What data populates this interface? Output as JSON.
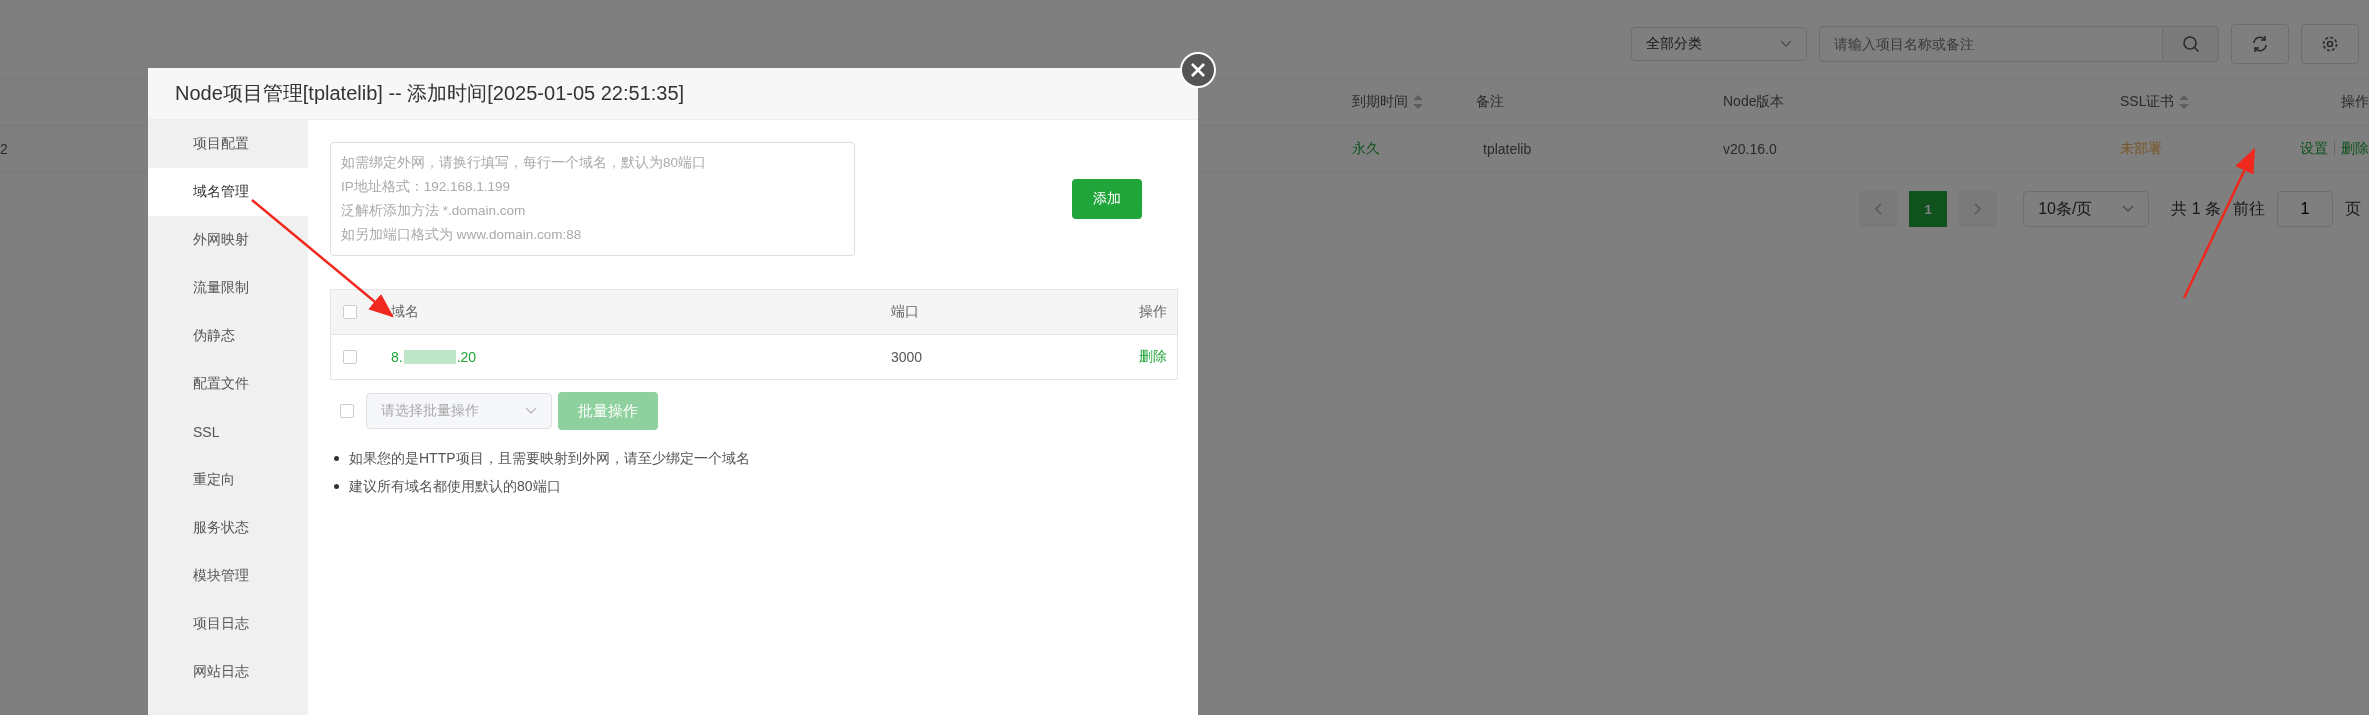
{
  "toolbar": {
    "category_select": "全部分类",
    "search": {
      "placeholder": "请输入项目名称或备注"
    }
  },
  "table": {
    "columns": [
      {
        "label": "到期时间",
        "sortable": true
      },
      {
        "label": "备注",
        "sortable": false
      },
      {
        "label": "Node版本",
        "sortable": false
      },
      {
        "label": "SSL证书",
        "sortable": true
      },
      {
        "label": "操作",
        "sortable": false
      }
    ],
    "rows": [
      {
        "cut_cell": "2",
        "cells": [
          "永久",
          "tplatelib",
          "v20.16.0",
          "未部署"
        ],
        "actions": [
          "设置",
          "删除"
        ]
      }
    ]
  },
  "pagination": {
    "pages": [
      {
        "label": "1",
        "selected": true
      }
    ],
    "page_size": "10条/页",
    "total": "共 1 条",
    "goto_label": "前往",
    "goto_value": "1",
    "page_suffix": "页"
  },
  "dialog": {
    "title": "Node项目管理[tplatelib] -- 添加时间[2025-01-05 22:51:35]",
    "menu": [
      {
        "label": "项目配置",
        "selected": false
      },
      {
        "label": "域名管理",
        "selected": true
      },
      {
        "label": "外网映射",
        "selected": false
      },
      {
        "label": "流量限制",
        "selected": false
      },
      {
        "label": "伪静态",
        "selected": false
      },
      {
        "label": "配置文件",
        "selected": false
      },
      {
        "label": "SSL",
        "selected": false
      },
      {
        "label": "重定向",
        "selected": false
      },
      {
        "label": "服务状态",
        "selected": false
      },
      {
        "label": "模块管理",
        "selected": false
      },
      {
        "label": "项目日志",
        "selected": false
      },
      {
        "label": "网站日志",
        "selected": false
      }
    ],
    "domain_input": {
      "placeholder_lines": [
        "如需绑定外网，请换行填写，每行一个域名，默认为80端口",
        "IP地址格式：192.168.1.199",
        "泛解析添加方法 *.domain.com",
        "如另加端口格式为 www.domain.com:88"
      ]
    },
    "add_button": "添加",
    "domain_table": {
      "select_all_checked": false,
      "columns": [
        "域名",
        "端口",
        "操作"
      ],
      "rows": [
        {
          "domain_start": "8.",
          "domain_end": ".20",
          "port": "3000",
          "action": "删除",
          "checked": false
        }
      ]
    },
    "batch": {
      "checked": false,
      "placeholder": "请选择批量操作",
      "button": "批量操作",
      "button_disabled": true
    },
    "notes": [
      "如果您的是HTTP项目，且需要映射到外网，请至少绑定一个域名",
      "建议所有域名都使用默认的80端口"
    ]
  }
}
